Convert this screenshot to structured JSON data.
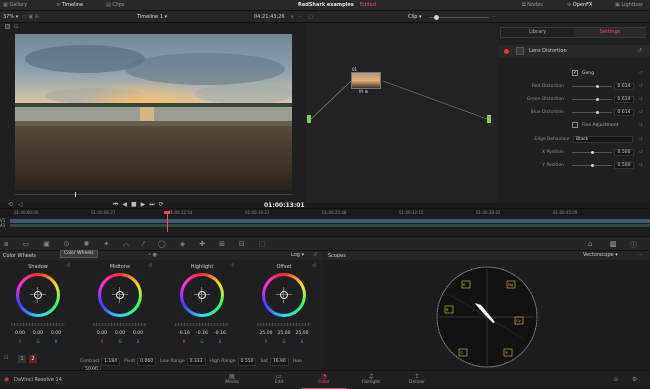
{
  "topbar": {
    "gallery": "Gallery",
    "timeline": "Timeline",
    "clips": "Clips",
    "project": "RedShark examples",
    "project_status": "Edited",
    "nodes": "Nodes",
    "openfx": "OpenFX",
    "lightbox": "Lightbox"
  },
  "viewer_bar": {
    "zoom": "37%",
    "timeline_name": "Timeline 1",
    "timecode": "04:21:43:26",
    "mode": "Clip"
  },
  "viewer": {
    "timecode": "01:00:13:01"
  },
  "node": {
    "label": "01"
  },
  "settings": {
    "tab_library": "Library",
    "tab_settings": "Settings",
    "effect_name": "Lens Distortion",
    "geng_label": "Geng",
    "rows": [
      {
        "label": "Red Distortion",
        "value": "0.614",
        "level": 0.614
      },
      {
        "label": "Green Distortion",
        "value": "0.614",
        "level": 0.614
      },
      {
        "label": "Blue Distortion",
        "value": "0.614",
        "level": 0.614
      }
    ],
    "fine_adjust": "Fine Adjustment",
    "edge_label": "Edge Behaviour",
    "edge_value": "Black",
    "pos_rows": [
      {
        "label": "X Position",
        "value": "0.500",
        "level": 0.5
      },
      {
        "label": "Y Position",
        "value": "0.500",
        "level": 0.5
      }
    ]
  },
  "timeline_ruler": [
    "01:00:00:00",
    "01:00:06:27",
    "01:00:12:54",
    "01:00:19:21",
    "01:00:25:48",
    "01:00:32:15",
    "01:00:38:42",
    "01:00:45:09"
  ],
  "timeline_tracks": [
    "V1",
    "A1"
  ],
  "color_wheels": {
    "title": "Color Wheels",
    "tooltip": "Color Wheels",
    "mode": "Log",
    "wheels": [
      {
        "name": "Shadow",
        "values": [
          "0.00",
          "0.00",
          "0.00"
        ],
        "labels": [
          "R",
          "G",
          "B"
        ]
      },
      {
        "name": "Midtone",
        "values": [
          "0.00",
          "0.00",
          "0.00"
        ],
        "labels": [
          "R",
          "G",
          "B"
        ]
      },
      {
        "name": "Highlight",
        "values": [
          "-0.16",
          "-0.16",
          "-0.16"
        ],
        "labels": [
          "R",
          "G",
          "B"
        ]
      },
      {
        "name": "Offset",
        "values": [
          "25.00",
          "25.00",
          "25.00"
        ],
        "labels": [
          "R",
          "G",
          "B"
        ]
      }
    ],
    "page_nums": [
      "1",
      "2"
    ],
    "params": [
      {
        "label": "Contrast",
        "value": "1.184"
      },
      {
        "label": "Pivot",
        "value": "0.060"
      },
      {
        "label": "Low Range",
        "value": "0.333"
      },
      {
        "label": "High Range",
        "value": "0.550"
      },
      {
        "label": "Sat",
        "value": "76.90"
      },
      {
        "label": "Hue",
        "value": "50.00"
      }
    ]
  },
  "scopes": {
    "title": "Scopes",
    "mode": "Vectorscope",
    "targets": [
      "R",
      "Mg",
      "B",
      "Cy",
      "G",
      "Yl"
    ]
  },
  "bottombar": {
    "app": "DaVinci Resolve 14",
    "nav": [
      "Media",
      "Edit",
      "Color",
      "Fairlight",
      "Deliver"
    ]
  },
  "colors": {
    "accent": "#ff4a55",
    "node_green": "#7bd14a"
  }
}
